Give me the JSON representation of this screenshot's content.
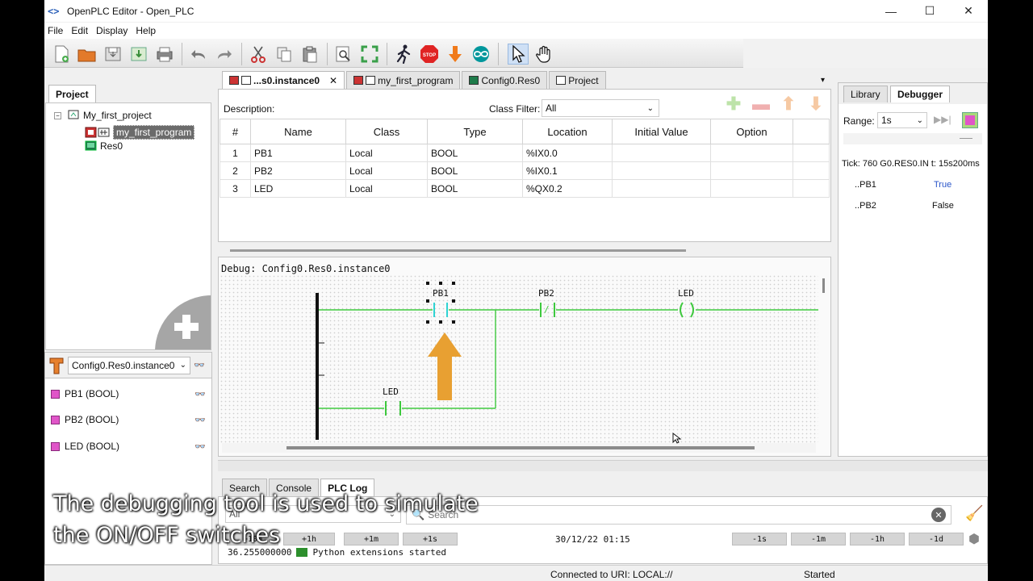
{
  "window": {
    "title": "OpenPLC Editor - Open_PLC",
    "app_icon": "<>",
    "controls": {
      "minimize": "—",
      "maximize": "☐",
      "close": "✕"
    }
  },
  "menu": [
    "File",
    "Edit",
    "Display",
    "Help"
  ],
  "toolbar_icons": [
    "new-file-icon",
    "open-folder-icon",
    "save-icon",
    "save-as-icon",
    "print-icon",
    "undo-icon",
    "redo-icon",
    "cut-icon",
    "copy-icon",
    "paste-icon",
    "search-zoom-icon",
    "fullscreen-icon",
    "run-icon",
    "stop-icon",
    "download-icon",
    "arduino-icon",
    "pointer-icon",
    "hand-icon"
  ],
  "project_panel": {
    "tab": "Project",
    "tree": {
      "root": "My_first_project",
      "program": "my_first_program",
      "resource": "Res0"
    }
  },
  "instance_panel": {
    "selector": "Config0.Res0.instance0",
    "vars": [
      "PB1 (BOOL)",
      "PB2 (BOOL)",
      "LED (BOOL)"
    ]
  },
  "editor_tabs": [
    {
      "label": "...s0.instance0",
      "active": true,
      "closable": true
    },
    {
      "label": "my_first_program",
      "active": false
    },
    {
      "label": "Config0.Res0",
      "active": false
    },
    {
      "label": "Project",
      "active": false
    }
  ],
  "var_editor": {
    "description_label": "Description:",
    "class_filter_label": "Class Filter:",
    "class_filter_value": "All",
    "columns": [
      "#",
      "Name",
      "Class",
      "Type",
      "Location",
      "Initial Value",
      "Option"
    ],
    "rows": [
      {
        "n": "1",
        "name": "PB1",
        "class": "Local",
        "type": "BOOL",
        "location": "%IX0.0",
        "initial": "",
        "option": ""
      },
      {
        "n": "2",
        "name": "PB2",
        "class": "Local",
        "type": "BOOL",
        "location": "%IX0.1",
        "initial": "",
        "option": ""
      },
      {
        "n": "3",
        "name": "LED",
        "class": "Local",
        "type": "BOOL",
        "location": "%QX0.2",
        "initial": "",
        "option": ""
      }
    ]
  },
  "ladder": {
    "debug_label": "Debug: Config0.Res0.instance0",
    "contacts": {
      "pb1": "PB1",
      "pb2": "PB2",
      "led_coil": "LED",
      "led_contact": "LED"
    },
    "pb2_symbol": "/",
    "coil_symbol": "( )"
  },
  "right_panel": {
    "tabs": [
      "Library",
      "Debugger"
    ],
    "range_label": "Range:",
    "range_value": "1s",
    "tick_text": "Tick: 760  G0.RES0.IN  t: 15s200ms",
    "vars": [
      {
        "name": "..PB1",
        "value": "True"
      },
      {
        "name": "..PB2",
        "value": "False"
      }
    ],
    "colors": {
      "true": "#2b56c9",
      "false": "#333333"
    }
  },
  "bottom_panel": {
    "tabs": [
      "Search",
      "Console",
      "PLC Log"
    ],
    "active_tab": "PLC Log",
    "filter_value": "All",
    "search_placeholder": "Search",
    "nav_buttons_left": [
      "+10m",
      "+1h",
      "+1m",
      "+1s"
    ],
    "timestamp": "30/12/22 01:15",
    "nav_buttons_right": [
      "-1s",
      "-1m",
      "-1h",
      "-1d"
    ],
    "log_entry": {
      "time": "36.255000000",
      "message": "Python extensions started"
    }
  },
  "status": {
    "connection": "Connected to URI: LOCAL://",
    "state": "Started"
  },
  "caption": {
    "line1": "The debugging tool is used to simulate",
    "line2": "the ON/OFF switches"
  }
}
